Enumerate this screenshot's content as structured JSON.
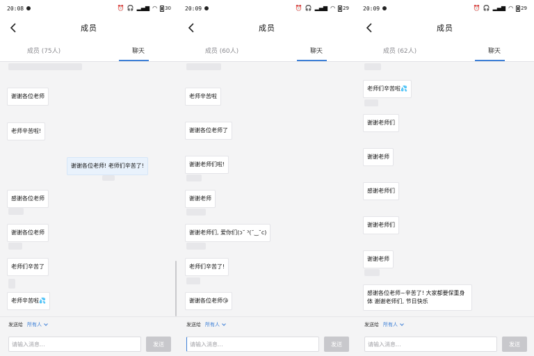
{
  "screens": [
    {
      "status": {
        "time": "20:08",
        "battery": "30"
      },
      "nav": {
        "title": "成员"
      },
      "tabs": [
        {
          "label": "成员 (75人)"
        },
        {
          "label": "聊天"
        }
      ],
      "messages": [
        {
          "text": "谢谢各位老师"
        },
        {
          "text": "老师辛苦啦!"
        },
        {
          "text": "谢谢各位老师! 老师们辛苦了!"
        },
        {
          "text": "感谢各位老师"
        },
        {
          "text": "谢谢各位老师"
        },
        {
          "text": "老师们辛苦了"
        },
        {
          "text": "老师辛苦啦💦"
        }
      ],
      "composer": {
        "sendto_label": "发送给",
        "sendto_value": "所有人",
        "placeholder": "请输入消息...",
        "send": "发送"
      }
    },
    {
      "status": {
        "time": "20:09",
        "battery": "29"
      },
      "nav": {
        "title": "成员"
      },
      "tabs": [
        {
          "label": "成员 (60人)"
        },
        {
          "label": "聊天"
        }
      ],
      "messages": [
        {
          "text": "老师辛苦啦"
        },
        {
          "text": "谢谢各位老师了"
        },
        {
          "text": "谢谢老师们啦!"
        },
        {
          "text": "谢谢老师"
        },
        {
          "text": "谢谢老师们, 爱你们(ɔ˘ ³(˘‿˘c)"
        },
        {
          "text": "老师们辛苦了!"
        },
        {
          "text": "谢谢各位老师😘"
        }
      ],
      "composer": {
        "sendto_label": "发送给",
        "sendto_value": "所有人",
        "placeholder": "请输入消息...",
        "send": "发送"
      }
    },
    {
      "status": {
        "time": "20:09",
        "battery": "29"
      },
      "nav": {
        "title": "成员"
      },
      "tabs": [
        {
          "label": "成员 (62人)"
        },
        {
          "label": "聊天"
        }
      ],
      "messages": [
        {
          "text": "老师们辛苦啦💦"
        },
        {
          "text": "谢谢老师们"
        },
        {
          "text": "谢谢老师"
        },
        {
          "text": "感谢老师们"
        },
        {
          "text": "谢谢老师们"
        },
        {
          "text": "谢谢老师"
        },
        {
          "text": "感谢各位老师~辛苦了! 大家都要保重身体 谢谢老师们, 节日快乐"
        }
      ],
      "composer": {
        "sendto_label": "发送给",
        "sendto_value": "所有人",
        "placeholder": "请输入消息...",
        "send": "发送"
      }
    }
  ],
  "colors": {
    "accent": "#3d7fd6",
    "bubble_self": "#e9f2fc",
    "background": "#f4f4f5"
  }
}
